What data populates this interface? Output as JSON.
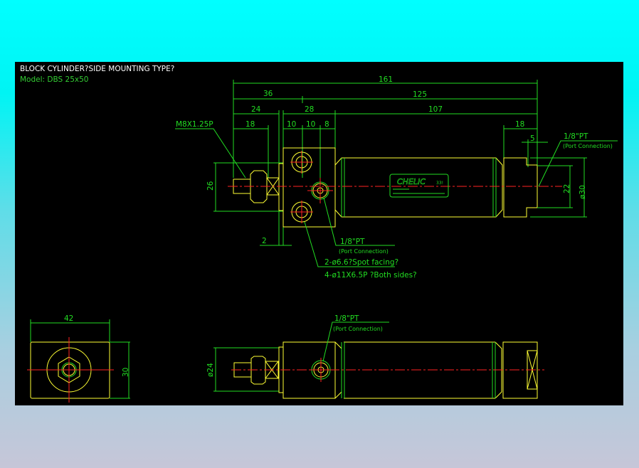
{
  "drawing": {
    "title": "BLOCK CYLINDER?SIDE MOUNTING TYPE?",
    "model": "Model:  DBS 25x50",
    "brand_label": "CHELIC",
    "brand_code": "33!",
    "colors": {
      "background": "#000000",
      "outline": "#ffff33",
      "dimension": "#22dd22",
      "centerline": "#ff2222",
      "title": "#ffffff"
    },
    "dimensions": {
      "overall": "161",
      "d36": "36",
      "d125": "125",
      "d24": "24",
      "d28": "28",
      "d107": "107",
      "d18_left": "18",
      "d10a": "10",
      "d10b": "10",
      "d8": "8",
      "d18_right": "18",
      "d5": "5",
      "d26": "26",
      "d2": "2",
      "d22": "22",
      "d30_dia": "ø30",
      "d42": "42",
      "d30": "30",
      "d24_dia": "ø24"
    },
    "annotations": {
      "thread": "M8X1.25P",
      "port_right": "1/8\"PT",
      "port_right_sub": "(Port Connection)",
      "port_mid": "1/8\"PT",
      "port_mid_sub": "(Port Connection)",
      "spot_facing": "2-ø6.6?Spot facing?",
      "counterbore": "4-ø11X6.5P ?Both sides?",
      "port_bottom": "1/8\"PT",
      "port_bottom_sub": "(Port Connection)"
    }
  }
}
